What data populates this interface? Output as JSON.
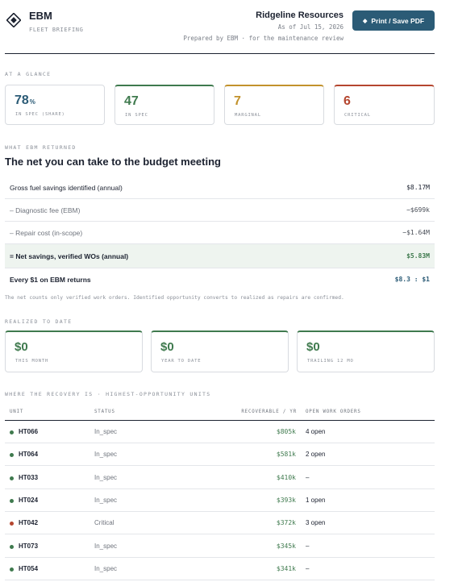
{
  "header": {
    "brand": "EBM",
    "subtitle": "FLEET BRIEFING",
    "client": "Ridgeline Resources",
    "as_of": "As of Jul 15, 2026",
    "prepared": "Prepared by EBM · for the maintenance review",
    "print_button": "Print / Save PDF",
    "print_icon": "diamond-icon",
    "logo_icon": "ebm-diamond-logo"
  },
  "glance": {
    "label": "AT A GLANCE",
    "cards": [
      {
        "value": "78",
        "unit": "%",
        "label": "IN SPEC (SHARE)",
        "color": "#2b5b76"
      },
      {
        "value": "47",
        "unit": "",
        "label": "IN SPEC",
        "color": "#3f7a4e"
      },
      {
        "value": "7",
        "unit": "",
        "label": "MARGINAL",
        "color": "#c2922c"
      },
      {
        "value": "6",
        "unit": "",
        "label": "CRITICAL",
        "color": "#b5462f"
      }
    ]
  },
  "net": {
    "label": "WHAT EBM RETURNED",
    "title": "The net you can take to the budget meeting",
    "rows": [
      {
        "label": "Gross fuel savings identified (annual)",
        "value": "$8.17M"
      },
      {
        "label": "– Diagnostic fee (EBM)",
        "value": "−$699k"
      },
      {
        "label": "– Repair cost (in-scope)",
        "value": "−$1.64M"
      },
      {
        "label": "= Net savings, verified WOs (annual)",
        "value": "$5.83M"
      },
      {
        "label": "Every $1 on EBM returns",
        "value": "$8.3 : $1"
      }
    ],
    "footnote": "The net counts only verified work orders. Identified opportunity converts to realized as repairs are confirmed."
  },
  "realized": {
    "label": "REALIZED TO DATE",
    "cards": [
      {
        "value": "$0",
        "label": "THIS MONTH"
      },
      {
        "value": "$0",
        "label": "YEAR TO DATE"
      },
      {
        "value": "$0",
        "label": "TRAILING 12 MO"
      }
    ]
  },
  "units": {
    "label": "WHERE THE RECOVERY IS · HIGHEST-OPPORTUNITY UNITS",
    "headers": {
      "unit": "UNIT",
      "status": "STATUS",
      "recoverable": "RECOVERABLE / YR",
      "work_orders": "OPEN WORK ORDERS"
    },
    "rows": [
      {
        "unit": "HT066",
        "status": "In_spec",
        "recoverable": "$805k",
        "work_orders": "4 open",
        "dot_color": "#3f7a4e"
      },
      {
        "unit": "HT064",
        "status": "In_spec",
        "recoverable": "$581k",
        "work_orders": "2 open",
        "dot_color": "#3f7a4e"
      },
      {
        "unit": "HT033",
        "status": "In_spec",
        "recoverable": "$410k",
        "work_orders": "–",
        "dot_color": "#3f7a4e"
      },
      {
        "unit": "HT024",
        "status": "In_spec",
        "recoverable": "$393k",
        "work_orders": "1 open",
        "dot_color": "#3f7a4e"
      },
      {
        "unit": "HT042",
        "status": "Critical",
        "recoverable": "$372k",
        "work_orders": "3 open",
        "dot_color": "#b5462f"
      },
      {
        "unit": "HT073",
        "status": "In_spec",
        "recoverable": "$345k",
        "work_orders": "–",
        "dot_color": "#3f7a4e"
      },
      {
        "unit": "HT054",
        "status": "In_spec",
        "recoverable": "$341k",
        "work_orders": "–",
        "dot_color": "#3f7a4e"
      }
    ]
  }
}
